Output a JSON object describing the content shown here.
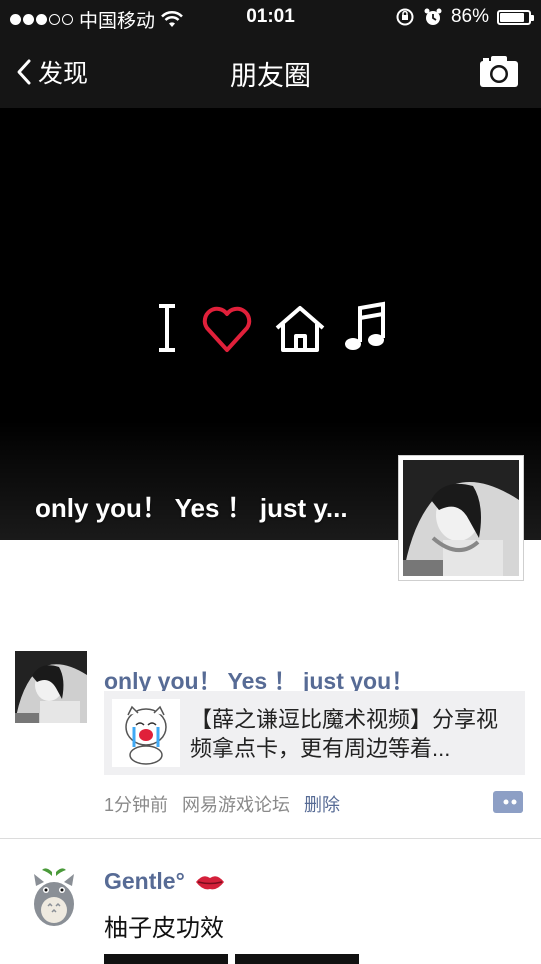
{
  "status_bar": {
    "carrier": "中国移动",
    "time": "01:01",
    "battery": "86%",
    "battery_level": 0.86
  },
  "nav": {
    "back_label": "发现",
    "title": "朋友圈"
  },
  "cover": {
    "username": "only you！ Yes ！ just y..."
  },
  "posts": [
    {
      "name": "only you！ Yes ！ just you！",
      "share_text": "【薛之谦逗比魔术视频】分享视频拿点卡，更有周边等着...",
      "time": "1分钟前",
      "source": "网易游戏论坛",
      "delete_label": "删除"
    },
    {
      "name": "Gentle°",
      "text": "柚子皮功效"
    }
  ],
  "colors": {
    "nav_bg": "#151515",
    "link": "#576b95",
    "heart": "#e0203a"
  }
}
